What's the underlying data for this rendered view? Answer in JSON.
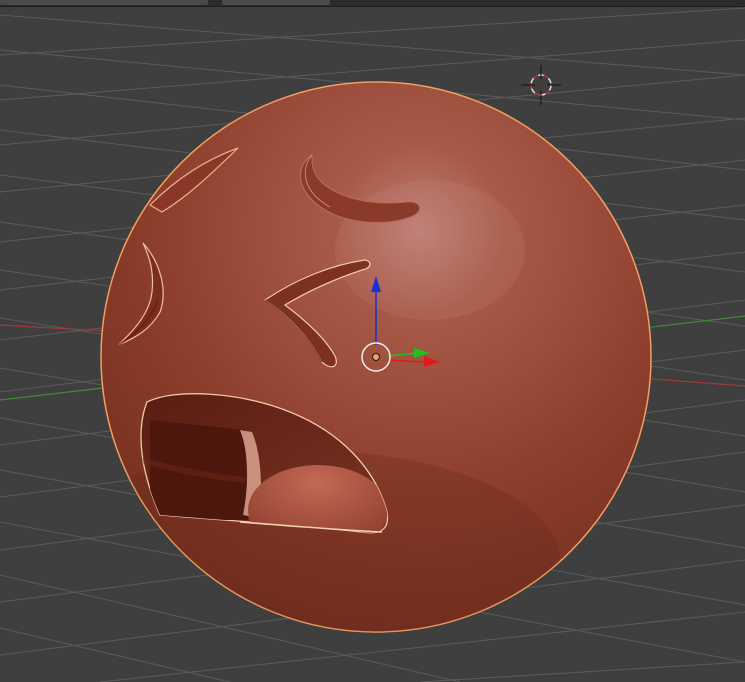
{
  "app": {
    "name": "3D Viewport"
  },
  "colors": {
    "background": "#3f3f3f",
    "grid": "#5a5a5a",
    "x_axis": "#a03a3a",
    "y_axis": "#4a8a3a",
    "object_base": "#9a4534",
    "selection_outline": "#f0a060",
    "gizmo_z": "#1d2fd6",
    "gizmo_y": "#1ec21e",
    "gizmo_x": "#e01a1a"
  },
  "icons": {
    "cursor": "3d-cursor-icon",
    "origin": "object-origin-icon",
    "gizmo": "translate-gizmo-icon"
  },
  "object": {
    "state": "selected"
  }
}
